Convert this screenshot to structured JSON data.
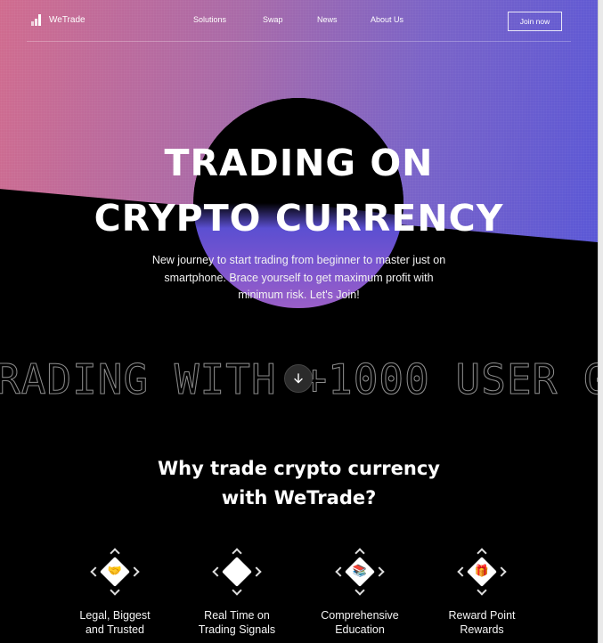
{
  "brand": {
    "name": "WeTrade"
  },
  "nav": {
    "links": [
      "Solutions",
      "Swap",
      "News",
      "About Us"
    ],
    "cta": "Join now"
  },
  "hero": {
    "title_line1": "TRADING ON",
    "title_line2": "CRYPTO CURRENCY",
    "subtitle": "New journey to start trading from beginner to master just on smartphone. Brace yourself to get maximum profit with minimum risk. Let's Join!"
  },
  "marquee": {
    "text": "RADING WITH +1000 USER G"
  },
  "scroll_button": {
    "icon": "arrow-down-icon"
  },
  "why": {
    "title_line1": "Why trade crypto currency",
    "title_line2": "with WeTrade?"
  },
  "features": [
    {
      "line1": "Legal, Biggest",
      "line2": "and Trusted",
      "icon": "handshake-icon",
      "glyph": "🤝"
    },
    {
      "line1": "Real Time on",
      "line2": "Trading Signals",
      "icon": "coffee-icon",
      "glyph": "☕"
    },
    {
      "line1": "Comprehensive",
      "line2": "Education",
      "icon": "books-icon",
      "glyph": "📚"
    },
    {
      "line1": "Reward Point",
      "line2": "Rewards",
      "icon": "gift-icon",
      "glyph": "🎁"
    }
  ],
  "colors": {
    "gradient_left": "#d06b8e",
    "gradient_right": "#5a57d6",
    "background": "#000000",
    "text": "#ffffff"
  }
}
